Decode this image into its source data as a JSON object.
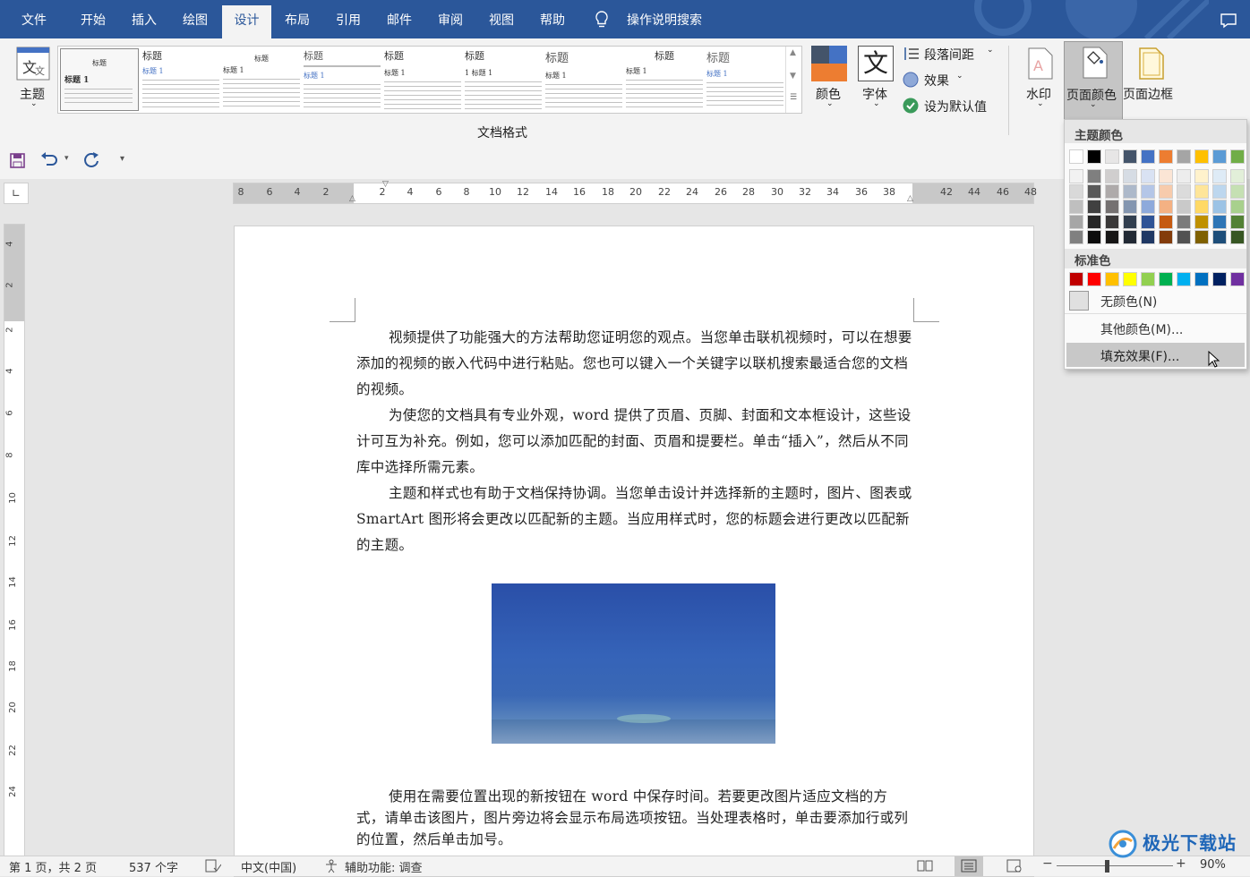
{
  "tabs": [
    "文件",
    "开始",
    "插入",
    "绘图",
    "设计",
    "布局",
    "引用",
    "邮件",
    "审阅",
    "视图",
    "帮助"
  ],
  "active_tab": "设计",
  "tell_me": "操作说明搜索",
  "ribbon": {
    "theme_label": "主题",
    "gallery_group_label": "文档格式",
    "gallery_items": [
      {
        "title": "标题",
        "heading": "标题 1"
      },
      {
        "title": "标题",
        "heading": "标题 1"
      },
      {
        "title": "标题",
        "heading": "标题 1"
      },
      {
        "title": "标题",
        "heading": "标题 1"
      },
      {
        "title": "标题",
        "heading": "标题 1"
      },
      {
        "title": "标题",
        "heading": "1 标题 1"
      },
      {
        "title": "标题",
        "heading": "标题 1"
      },
      {
        "title": "标题",
        "heading": "标题 1"
      },
      {
        "title": "标题",
        "heading": "标题 1"
      }
    ],
    "colors_label": "颜色",
    "fonts_label": "字体",
    "fonts_icon_char": "文",
    "paragraph_spacing_label": "段落间距",
    "effects_label": "效果",
    "set_default_label": "设为默认值",
    "watermark_label": "水印",
    "page_color_label": "页面颜色",
    "page_borders_label": "页面边框"
  },
  "ruler": {
    "h_ticks": [
      "8",
      "6",
      "4",
      "2",
      "2",
      "4",
      "6",
      "8",
      "10",
      "12",
      "14",
      "16",
      "18",
      "20",
      "22",
      "24",
      "26",
      "28",
      "30",
      "32",
      "34",
      "36",
      "38",
      "42",
      "44",
      "46",
      "48"
    ],
    "v_ticks": [
      "4",
      "2",
      "2",
      "4",
      "6",
      "8",
      "10",
      "12",
      "14",
      "16",
      "18",
      "20",
      "22",
      "24"
    ]
  },
  "document": {
    "paragraphs": [
      "视频提供了功能强大的方法帮助您证明您的观点。当您单击联机视频时，可以在想要添加的视频的嵌入代码中进行粘贴。您也可以键入一个关键字以联机搜索最适合您的文档的视频。",
      "为使您的文档具有专业外观，word 提供了页眉、页脚、封面和文本框设计，这些设计可互为补充。例如，您可以添加匹配的封面、页眉和提要栏。单击“插入”，然后从不同库中选择所需元素。",
      "主题和样式也有助于文档保持协调。当您单击设计并选择新的主题时，图片、图表或 SmartArt 图形将会更改以匹配新的主题。当应用样式时，您的标题会进行更改以匹配新的主题。",
      "使用在需要位置出现的新按钮在 word 中保存时间。若要更改图片适应文档的方式，请单击该图片，图片旁边将会显示布局选项按钮。当处理表格时，单击要添加行或列的位置，然后单击加号。"
    ]
  },
  "dropdown": {
    "theme_colors_header": "主题颜色",
    "theme_top_row": [
      "#ffffff",
      "#000000",
      "#e7e6e6",
      "#44546a",
      "#4472c4",
      "#ed7d31",
      "#a5a5a5",
      "#ffc000",
      "#5b9bd5",
      "#70ad47"
    ],
    "theme_shades": [
      [
        "#f2f2f2",
        "#d9d9d9",
        "#bfbfbf",
        "#a6a6a6",
        "#808080"
      ],
      [
        "#7f7f7f",
        "#595959",
        "#404040",
        "#262626",
        "#0d0d0d"
      ],
      [
        "#d0cece",
        "#aeaaaa",
        "#757171",
        "#3a3838",
        "#171616"
      ],
      [
        "#d6dce4",
        "#adb9ca",
        "#8496b0",
        "#323f4f",
        "#222a35"
      ],
      [
        "#d9e2f3",
        "#b4c6e7",
        "#8eaadb",
        "#2f5496",
        "#1f3864"
      ],
      [
        "#fbe5d5",
        "#f7cbac",
        "#f4b183",
        "#c55a11",
        "#833c0b"
      ],
      [
        "#ededed",
        "#dbdbdb",
        "#c9c9c9",
        "#7b7b7b",
        "#525252"
      ],
      [
        "#fff2cc",
        "#fee599",
        "#ffd965",
        "#bf9000",
        "#7f6000"
      ],
      [
        "#deebf6",
        "#bdd7ee",
        "#9cc3e5",
        "#2e75b5",
        "#1e4e79"
      ],
      [
        "#e2efd9",
        "#c5e0b3",
        "#a8d08d",
        "#538135",
        "#375623"
      ]
    ],
    "standard_colors_header": "标准色",
    "standard_colors": [
      "#c00000",
      "#ff0000",
      "#ffc000",
      "#ffff00",
      "#92d050",
      "#00b050",
      "#00b0f0",
      "#0070c0",
      "#002060",
      "#7030a0"
    ],
    "no_color": "无颜色(N)",
    "more_colors": "其他颜色(M)...",
    "fill_effects": "填充效果(F)..."
  },
  "status": {
    "page": "第 1 页，共 2 页",
    "words": "537 个字",
    "language": "中文(中国)",
    "accessibility": "辅助功能: 调查",
    "zoom": "90%"
  },
  "watermark_logo": "极光下载站"
}
